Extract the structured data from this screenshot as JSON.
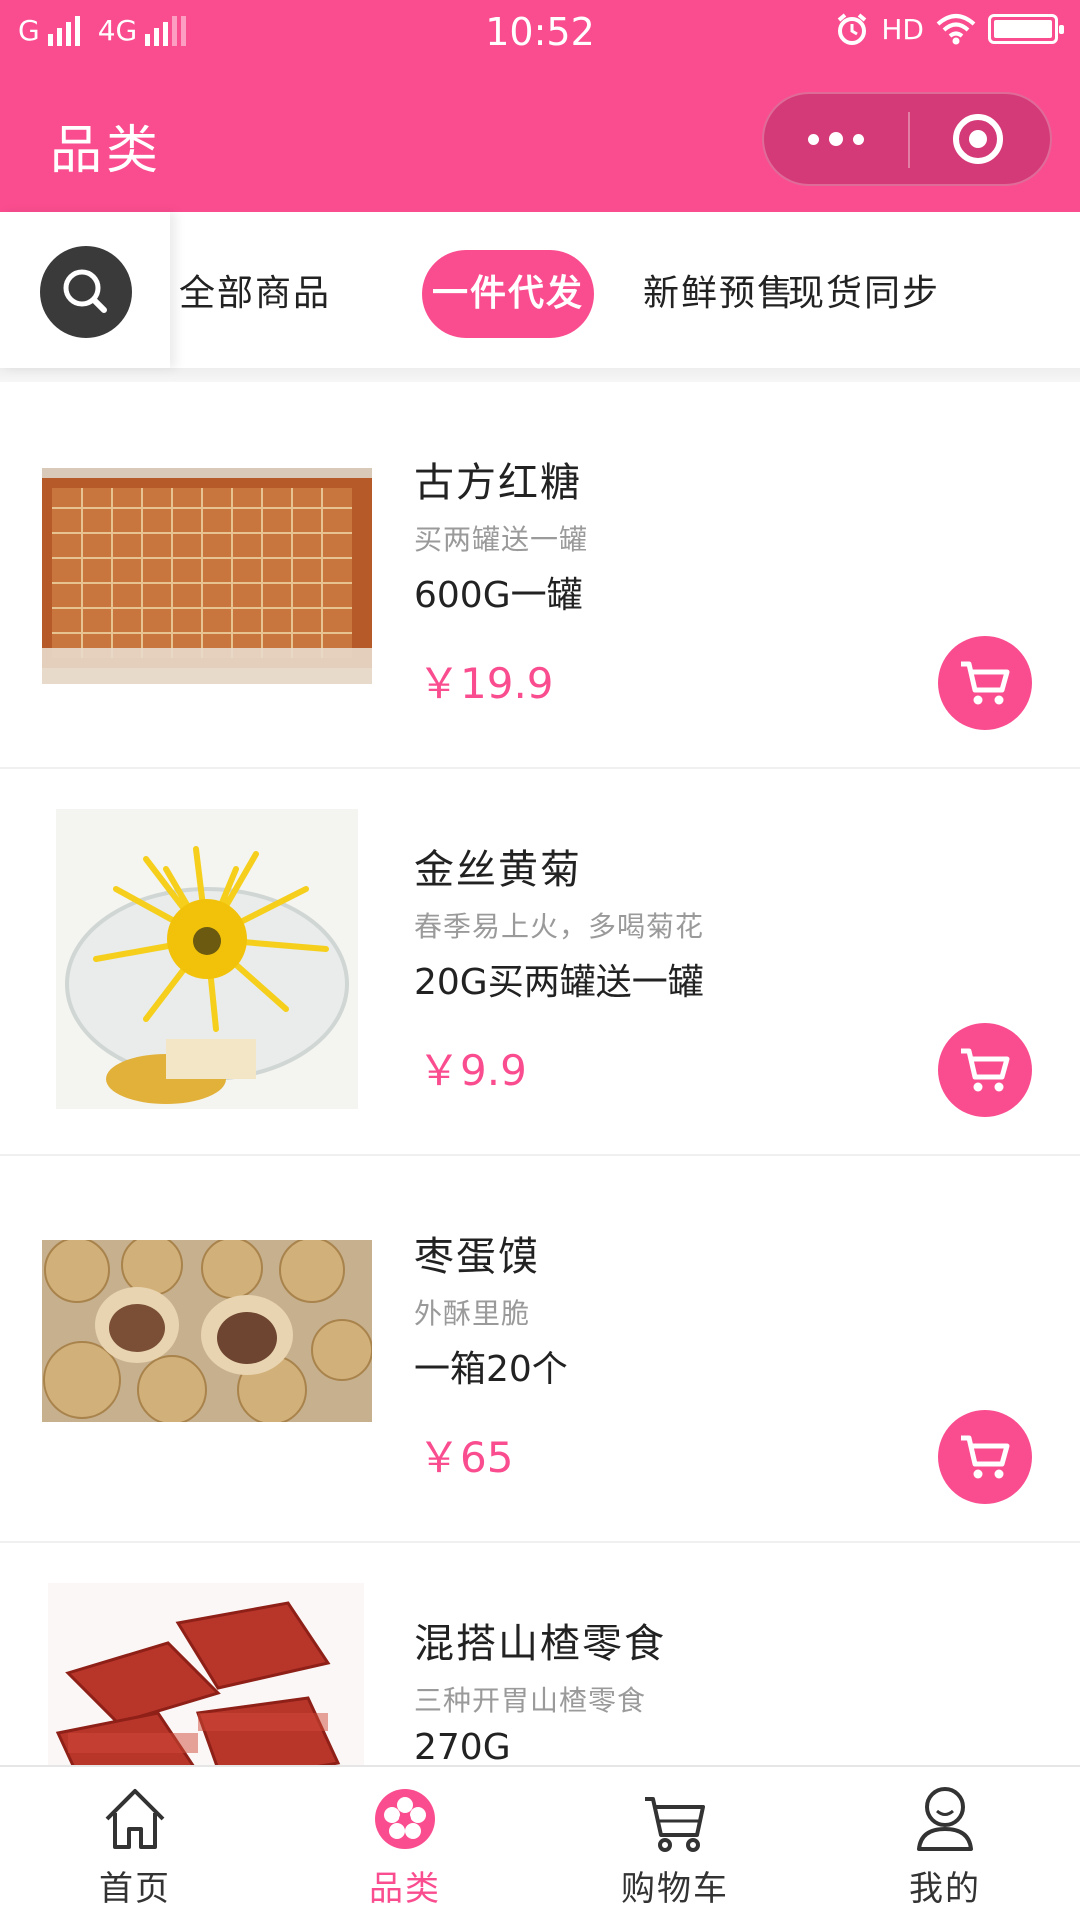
{
  "status_bar": {
    "network1": "G",
    "network2": "4G",
    "time": "10:52",
    "hd": "HD"
  },
  "header": {
    "title": "品类",
    "more_icon": "more-dots-icon",
    "close_icon": "target-circle-icon"
  },
  "categories": {
    "search_icon": "search-icon",
    "tabs": [
      {
        "label": "全部商品",
        "active": false
      },
      {
        "label": "一件代发",
        "active": true
      },
      {
        "label": "新鲜预售",
        "active": false
      },
      {
        "label": "现货同步",
        "active": false
      }
    ]
  },
  "products": [
    {
      "name": "古方红糖",
      "subtitle": "买两罐送一罐",
      "spec": "600G一罐",
      "price": "￥19.9",
      "image": "brown sugar slab"
    },
    {
      "name": "金丝黄菊",
      "subtitle": "春季易上火，多喝菊花",
      "spec": "20G买两罐送一罐",
      "price": "￥9.9",
      "image": "chrysanthemum tea"
    },
    {
      "name": "枣蛋馍",
      "subtitle": "外酥里脆",
      "spec": "一箱20个",
      "price": "￥65",
      "image": "date buns"
    },
    {
      "name": "混搭山楂零食",
      "subtitle": "三种开胃山楂零食",
      "spec": "270G",
      "price": "",
      "image": "hawthorn snacks"
    }
  ],
  "tabbar": {
    "items": [
      {
        "label": "首页",
        "icon": "home-icon",
        "active": false
      },
      {
        "label": "品类",
        "icon": "flower-category-icon",
        "active": true
      },
      {
        "label": "购物车",
        "icon": "cart-icon",
        "active": false
      },
      {
        "label": "我的",
        "icon": "user-icon",
        "active": false
      }
    ]
  },
  "colors": {
    "accent": "#fa4d8f",
    "text": "#222222",
    "subtext": "#9a9a9a"
  }
}
